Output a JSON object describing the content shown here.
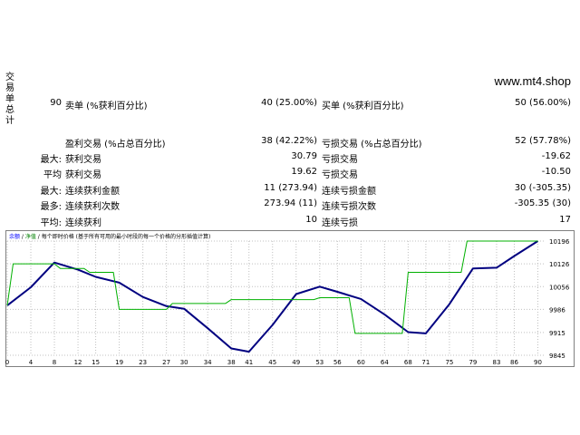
{
  "sidebar_label_chars": [
    "交",
    "易",
    "单",
    "总",
    "计"
  ],
  "site": "www.mt4.shop",
  "stats": {
    "total_trades": "90",
    "short_label": "卖单 (%获利百分比)",
    "short_value": "40 (25.00%)",
    "long_label": "买单 (%获利百分比)",
    "long_value": "50 (56.00%)",
    "profit_trades_label": "盈利交易 (%占总百分比)",
    "profit_trades_value": "38 (42.22%)",
    "loss_trades_label": "亏损交易 (%占总百分比)",
    "loss_trades_value": "52 (57.78%)",
    "largest_prefix": "最大:",
    "largest_profit_label": "获利交易",
    "largest_profit_value": "30.79",
    "largest_loss_label": "亏损交易",
    "largest_loss_value": "-19.62",
    "average_prefix": "平均",
    "average_profit_label": "获利交易",
    "average_profit_value": "19.62",
    "average_loss_label": "亏损交易",
    "average_loss_value": "-10.50",
    "max_prefix": "最大:",
    "max_consec_wins_label": "连续获利金额",
    "max_consec_wins_value": "11 (273.94)",
    "max_consec_losses_label": "连续亏损金额",
    "max_consec_losses_value": "30 (-305.35)",
    "most_prefix": "最多:",
    "max_consec_profit_label": "连续获利次数",
    "max_consec_profit_value": "273.94 (11)",
    "max_consec_loss_label": "连续亏损次数",
    "max_consec_loss_value": "-305.35 (30)",
    "avg_prefix": "平均:",
    "avg_consec_wins_label": "连续获利",
    "avg_consec_wins_value": "10",
    "avg_consec_losses_label": "连续亏损",
    "avg_consec_losses_value": "17"
  },
  "chart_data": {
    "type": "line",
    "legend_text": "余额 / 净值 / 每个即时价格 (基于所有可用的最小时段的每一个价格的分形插值计算)",
    "legend_parts": [
      {
        "text": "余额",
        "color": "#0000ff"
      },
      {
        "text": " / ",
        "color": "#000000"
      },
      {
        "text": "净值",
        "color": "#008000"
      },
      {
        "text": " / 每个即时价格 (基于所有可用的最小时段的每一个价格的分形插值计算)",
        "color": "#000000"
      }
    ],
    "x_ticks": [
      "0",
      "4",
      "8",
      "12",
      "15",
      "19",
      "23",
      "27",
      "30",
      "34",
      "38",
      "41",
      "45",
      "49",
      "53",
      "56",
      "60",
      "64",
      "68",
      "71",
      "75",
      "79",
      "83",
      "86",
      "90"
    ],
    "y_ticks": [
      "10196",
      "10126",
      "10056",
      "9986",
      "9915",
      "9845"
    ],
    "xlim": [
      0,
      91
    ],
    "ylim": [
      9845,
      10196
    ],
    "grid": true,
    "colors": {
      "balance": "#000080",
      "equity": "#00b000",
      "grid": "#c0c0c0"
    },
    "series": [
      {
        "name": "余额",
        "x": [
          0,
          4,
          8,
          12,
          15,
          19,
          23,
          27,
          30,
          34,
          38,
          41,
          45,
          49,
          53,
          56,
          60,
          64,
          68,
          71,
          75,
          79,
          83,
          86,
          90
        ],
        "values": [
          9998,
          10054,
          10130,
          10108,
          10086,
          10068,
          10024,
          9996,
          9988,
          9928,
          9866,
          9856,
          9938,
          10033,
          10056,
          10040,
          10018,
          9970,
          9916,
          9912,
          10002,
          10112,
          10114,
          10150,
          10196
        ]
      },
      {
        "name": "净值",
        "x": [
          0,
          1,
          2,
          8,
          9,
          13,
          14,
          18,
          19,
          27,
          28,
          37,
          38,
          52,
          53,
          58,
          59,
          67,
          68,
          77,
          78,
          90
        ],
        "values": [
          9998,
          10126,
          10126,
          10126,
          10112,
          10112,
          10100,
          10100,
          9986,
          9986,
          10004,
          10004,
          10016,
          10016,
          10022,
          10022,
          9912,
          9912,
          10100,
          10100,
          10196,
          10196
        ]
      }
    ]
  }
}
